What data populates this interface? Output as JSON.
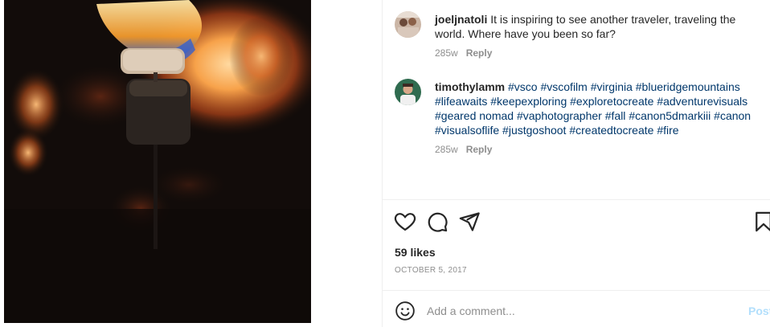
{
  "post": {
    "likes_text": "59 likes",
    "date_text": "OCTOBER 5, 2017"
  },
  "comments": [
    {
      "username": "joeljnatoli",
      "text": "It is inspiring to see another traveler, traveling the world. Where have you been so far?",
      "age": "285w",
      "reply_label": "Reply"
    },
    {
      "username": "timothylamm",
      "hashtags": [
        "#vsco",
        "#vscofilm",
        "#virginia",
        "#blueridgemountains",
        "#lifeawaits",
        "#keepexploring",
        "#exploretocreate",
        "#adventurevisuals",
        "#geared nomad",
        "#vaphotographer",
        "#fall",
        "#canon5dmarkiii",
        "#canon",
        "#visualsoflife",
        "#justgoshoot",
        "#createdtocreate",
        "#fire"
      ],
      "age": "285w",
      "reply_label": "Reply"
    }
  ],
  "comment_box": {
    "placeholder": "Add a comment...",
    "post_label": "Post"
  },
  "icons": {
    "like": "heart-icon",
    "comment": "comment-bubble-icon",
    "share": "paper-plane-icon",
    "save": "bookmark-icon",
    "emoji": "smiley-icon"
  },
  "colors": {
    "hashtag": "#00376b",
    "post_disabled": "#b2dffc",
    "muted": "#8e8e8e"
  }
}
